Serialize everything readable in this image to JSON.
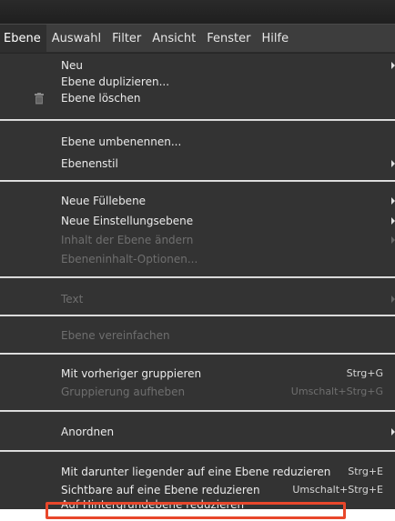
{
  "menubar": {
    "items": [
      "Ebene",
      "Auswahl",
      "Filter",
      "Ansicht",
      "Fenster",
      "Hilfe"
    ],
    "active_index": 0
  },
  "menu": {
    "items": [
      {
        "label": "Neu",
        "shortcut": "",
        "submenu": true,
        "disabled": false
      },
      {
        "label": "Ebene duplizieren...",
        "shortcut": "",
        "submenu": false,
        "disabled": false
      },
      {
        "label": "Ebene löschen",
        "shortcut": "",
        "submenu": false,
        "disabled": false,
        "icon": "trash-icon"
      },
      {
        "label": "Ebene umbenennen...",
        "shortcut": "",
        "submenu": false,
        "disabled": false
      },
      {
        "label": "Ebenenstil",
        "shortcut": "",
        "submenu": true,
        "disabled": false
      },
      {
        "label": "Neue Füllebene",
        "shortcut": "",
        "submenu": true,
        "disabled": false
      },
      {
        "label": "Neue Einstellungsebene",
        "shortcut": "",
        "submenu": true,
        "disabled": false
      },
      {
        "label": "Inhalt der Ebene ändern",
        "shortcut": "",
        "submenu": true,
        "disabled": true
      },
      {
        "label": "Ebeneninhalt-Optionen...",
        "shortcut": "",
        "submenu": false,
        "disabled": true
      },
      {
        "label": "Text",
        "shortcut": "",
        "submenu": true,
        "disabled": true
      },
      {
        "label": "Ebene vereinfachen",
        "shortcut": "",
        "submenu": false,
        "disabled": true
      },
      {
        "label": "Mit vorheriger gruppieren",
        "shortcut": "Strg+G",
        "submenu": false,
        "disabled": false
      },
      {
        "label": "Gruppierung aufheben",
        "shortcut": "Umschalt+Strg+G",
        "submenu": false,
        "disabled": true
      },
      {
        "label": "Anordnen",
        "shortcut": "",
        "submenu": true,
        "disabled": false
      },
      {
        "label": "Mit darunter liegender auf eine Ebene reduzieren",
        "shortcut": "Strg+E",
        "submenu": false,
        "disabled": false
      },
      {
        "label": "Sichtbare auf eine Ebene reduzieren",
        "shortcut": "Umschalt+Strg+E",
        "submenu": false,
        "disabled": false
      },
      {
        "label": "Auf Hintergrundebene reduzieren",
        "shortcut": "",
        "submenu": false,
        "disabled": false,
        "highlighted": true
      }
    ]
  },
  "colors": {
    "highlight_border": "#e8472b",
    "menu_background": "#333333",
    "menubar_background": "#3d3d3d",
    "separator": "#d0d0d0"
  }
}
